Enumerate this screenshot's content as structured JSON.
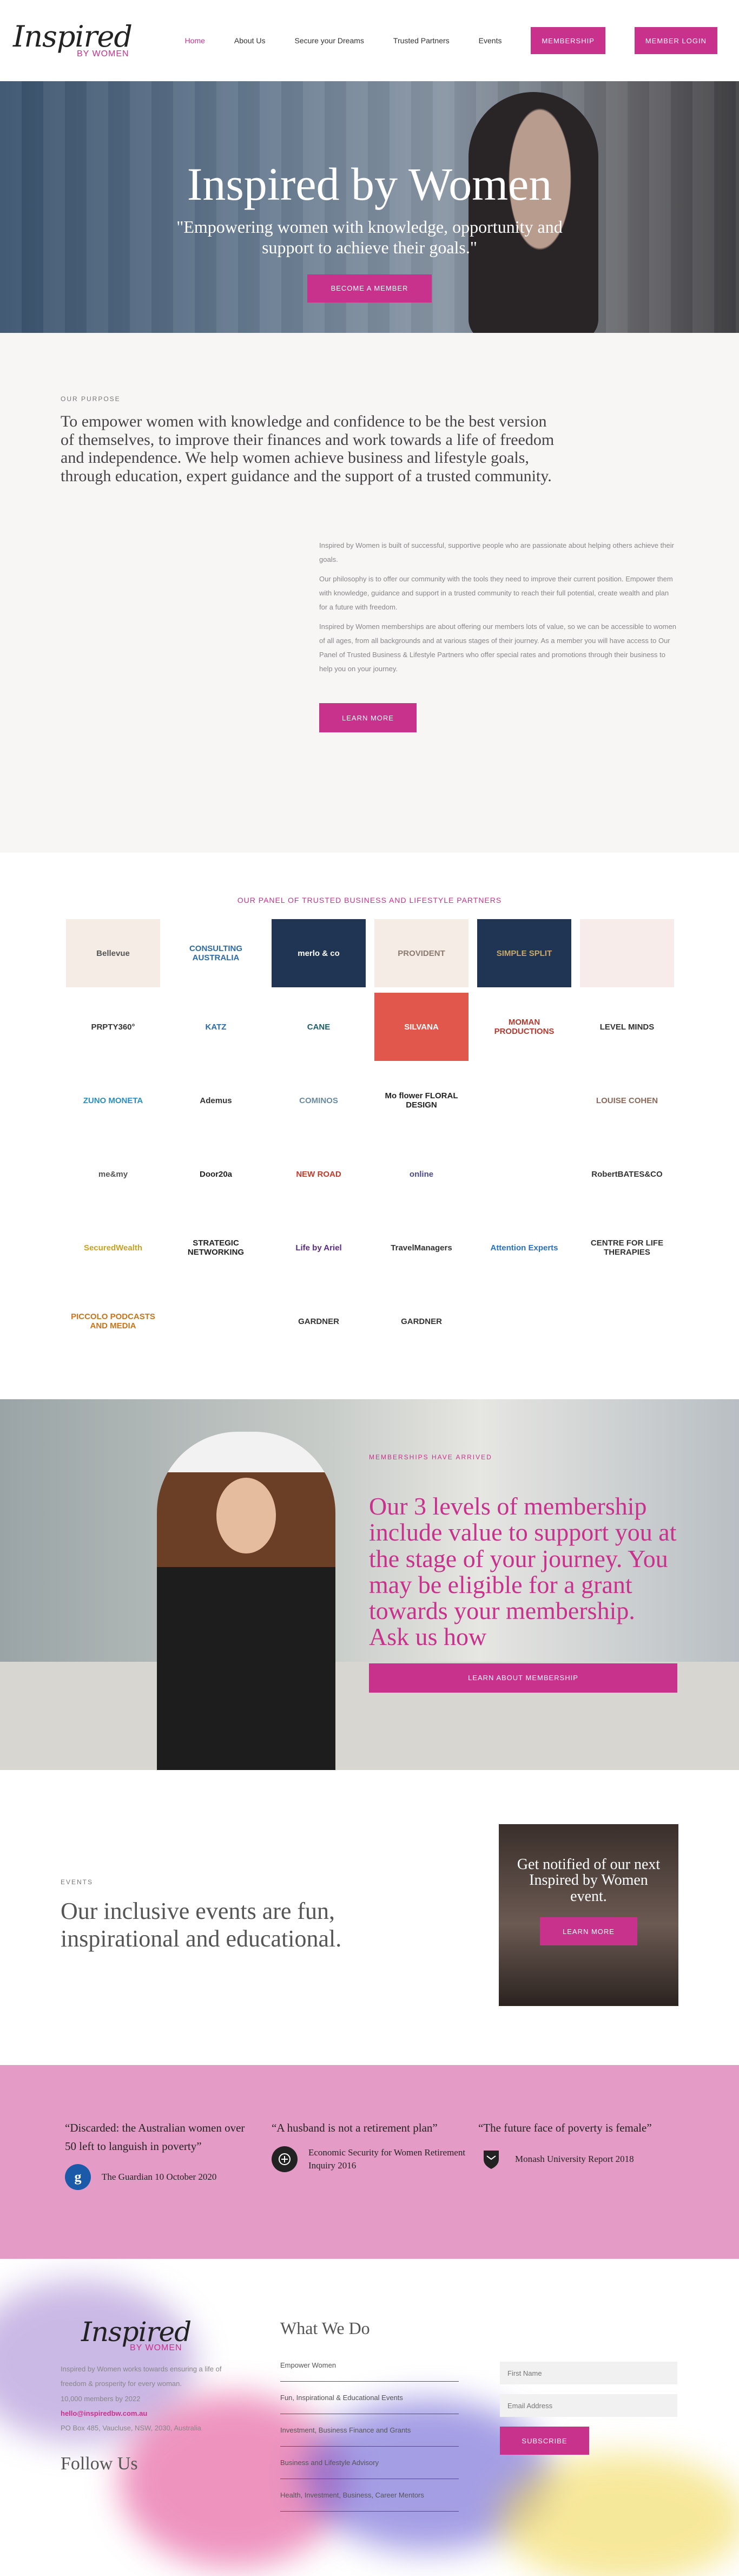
{
  "brand": {
    "logo_main": "Inspired",
    "logo_sub": "BY WOMEN",
    "accent": "#c8318c"
  },
  "nav": {
    "items": [
      "Home",
      "About Us",
      "Secure your Dreams",
      "Trusted Partners",
      "Events"
    ],
    "membership": "MEMBERSHIP",
    "login": "MEMBER LOGIN"
  },
  "hero": {
    "title": "Inspired by Women",
    "subtitle": "\"Empowering women with knowledge, opportunity and support to achieve their goals.\"",
    "cta": "BECOME A MEMBER"
  },
  "purpose": {
    "eyebrow": "OUR PURPOSE",
    "heading": "To empower women with knowledge and confidence to be the best version of themselves, to improve their finances and work towards a life of freedom and independence. We help women achieve business and lifestyle goals, through education, expert guidance and the support of a trusted community.",
    "p1": "Inspired by Women is built of successful, supportive people who are passionate about helping others achieve their goals.",
    "p2": "Our philosophy is to offer our community with the tools they need to improve their current position. Empower them with knowledge, guidance and support in a trusted community to reach their full potential, create wealth and plan for a future with freedom.",
    "p3": "Inspired by Women memberships are about offering our members lots of value, so we can be accessible to women of all ages, from all backgrounds and at various stages of their journey. As a member you will have access to Our Panel of Trusted Business & Lifestyle Partners who offer special rates and promotions through their business to help you on your journey.",
    "cta": "LEARN MORE"
  },
  "partners": {
    "heading": "OUR PANEL OF TRUSTED BUSINESS AND LIFESTYLE PARTNERS",
    "logos": [
      {
        "name": "Bellevue",
        "bg": "#f5ece6",
        "color": "#555"
      },
      {
        "name": "CONSULTING AUSTRALIA",
        "bg": "#ffffff",
        "color": "#2d6aa3"
      },
      {
        "name": "merlo & co",
        "bg": "#1f3553",
        "color": "#ffffff"
      },
      {
        "name": "PROVIDENT",
        "bg": "#f5ece6",
        "color": "#8a7a70"
      },
      {
        "name": "SIMPLE SPLIT",
        "bg": "#1f3553",
        "color": "#c9a96a"
      },
      {
        "name": "",
        "bg": "#f8ecea",
        "color": "#3bb07a"
      },
      {
        "name": "PRPTY360°",
        "bg": "#ffffff",
        "color": "#333"
      },
      {
        "name": "KATZ",
        "bg": "#ffffff",
        "color": "#2d6aa3"
      },
      {
        "name": "CANE",
        "bg": "#ffffff",
        "color": "#1f5c6a"
      },
      {
        "name": "SILVANA",
        "bg": "#e2574c",
        "color": "#ffffff"
      },
      {
        "name": "MOMAN PRODUCTIONS",
        "bg": "#ffffff",
        "color": "#b23a2f"
      },
      {
        "name": "LEVEL MINDS",
        "bg": "#ffffff",
        "color": "#333"
      },
      {
        "name": "ZUNO MONETA",
        "bg": "#ffffff",
        "color": "#2a8fbf"
      },
      {
        "name": "Ademus",
        "bg": "#ffffff",
        "color": "#333"
      },
      {
        "name": "COMINOS",
        "bg": "#ffffff",
        "color": "#6a8aa0"
      },
      {
        "name": "Mo flower FLORAL DESIGN",
        "bg": "#ffffff",
        "color": "#222"
      },
      {
        "name": "",
        "bg": "#ffffff",
        "color": "#a8322c"
      },
      {
        "name": "LOUISE COHEN",
        "bg": "#ffffff",
        "color": "#8a6a5a"
      },
      {
        "name": "me&my",
        "bg": "#ffffff",
        "color": "#555"
      },
      {
        "name": "Door20a",
        "bg": "#ffffff",
        "color": "#222"
      },
      {
        "name": "NEW ROAD",
        "bg": "#ffffff",
        "color": "#c0392b"
      },
      {
        "name": "online",
        "bg": "#ffffff",
        "color": "#4a4a8a"
      },
      {
        "name": "",
        "bg": "#ffffff",
        "color": "#555"
      },
      {
        "name": "RobertBATES&CO",
        "bg": "#ffffff",
        "color": "#333"
      },
      {
        "name": "SecuredWealth",
        "bg": "#ffffff",
        "color": "#c9a020"
      },
      {
        "name": "STRATEGIC NETWORKING",
        "bg": "#ffffff",
        "color": "#222"
      },
      {
        "name": "Life by Ariel",
        "bg": "#ffffff",
        "color": "#5b2a82"
      },
      {
        "name": "TravelManagers",
        "bg": "#ffffff",
        "color": "#333"
      },
      {
        "name": "Attention Experts",
        "bg": "#ffffff",
        "color": "#2a6fbf"
      },
      {
        "name": "CENTRE FOR LIFE THERAPIES",
        "bg": "#ffffff",
        "color": "#333"
      },
      {
        "name": "PICCOLO PODCASTS AND MEDIA",
        "bg": "#ffffff",
        "color": "#c9741a"
      },
      {
        "name": "",
        "bg": "#ffffff",
        "color": "#c0392b"
      },
      {
        "name": "GARDNER",
        "bg": "#ffffff",
        "color": "#333"
      },
      {
        "name": "GARDNER",
        "bg": "#ffffff",
        "color": "#333"
      },
      {
        "name": "",
        "bg": "#ffffff",
        "color": "#333"
      }
    ]
  },
  "membership": {
    "eyebrow": "MEMBERSHIPS HAVE ARRIVED",
    "heading": "Our 3 levels of membership include value to support you at the stage of your journey. You may be eligible for a grant towards your membership. Ask us how",
    "cta": "LEARN ABOUT MEMBERSHIP"
  },
  "events": {
    "eyebrow": "EVENTS",
    "heading": "Our inclusive events are fun, inspirational and educational.",
    "card_text": "Get notified of our next Inspired by Women event.",
    "card_cta": "LEARN MORE"
  },
  "quotes": [
    {
      "quote": "“Discarded: the Australian women over 50 left to languish in poverty”",
      "source": "The Guardian 10 October 2020",
      "icon": "g",
      "icon_bg": "#1a5aa8"
    },
    {
      "quote": "“A husband is not a retirement plan”",
      "source": "Economic Security for Women Retirement Inquiry 2016",
      "icon": "",
      "icon_bg": "#222222"
    },
    {
      "quote": "“The future face of poverty is female”",
      "source": "Monash University Report 2018",
      "icon": "",
      "icon_bg": "#222222"
    }
  ],
  "footer": {
    "text1": "Inspired by Women works towards ensuring a life of freedom & prosperity for every woman.",
    "members": "10,000 members by 2022",
    "email": "hello@inspiredbw.com.au",
    "address": "PO Box 485, Vaucluse, NSW, 2030, Australia",
    "follow": "Follow Us",
    "events_title": "What We Do",
    "events_items": [
      "Empower Women",
      "Fun, Inspirational & Educational Events",
      "Investment, Business Finance and Grants",
      "Business and Lifestyle Advisory",
      "Health, Investment, Business, Career Mentors"
    ],
    "first_name_placeholder": "First Name",
    "email_placeholder": "Email Address",
    "subscribe": "SUBSCRIBE"
  }
}
